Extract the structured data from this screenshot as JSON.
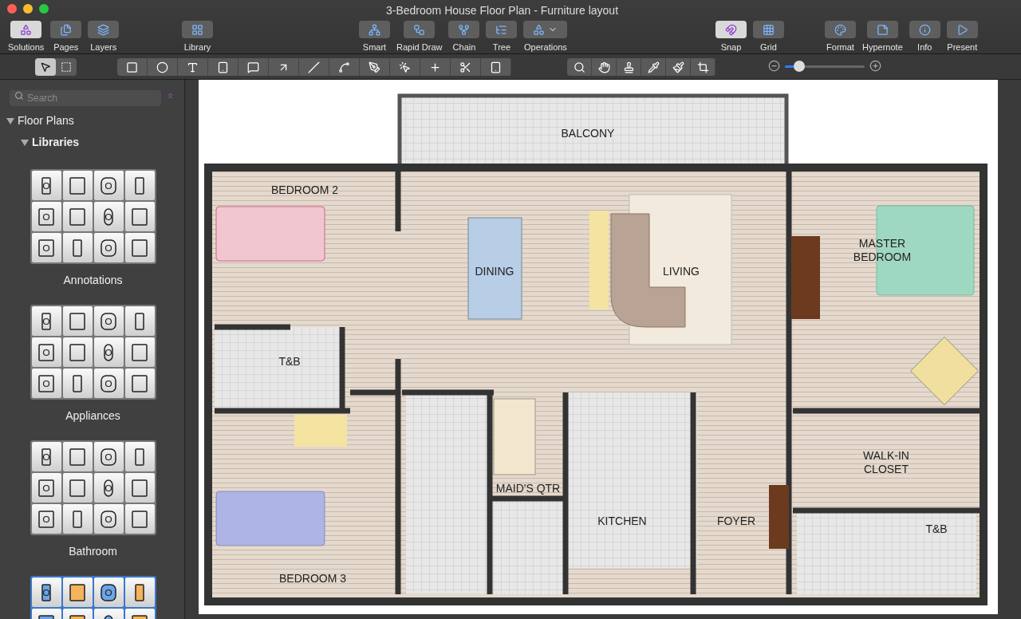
{
  "window": {
    "title": "3-Bedroom House Floor Plan - Furniture layout"
  },
  "toolbar": {
    "view_segments": [
      {
        "label": "Solutions",
        "selected": true
      },
      {
        "label": "Pages",
        "selected": false
      },
      {
        "label": "Layers",
        "selected": false
      }
    ],
    "library": "Library",
    "layout_tools": [
      "Smart",
      "Rapid Draw",
      "Chain",
      "Tree",
      "Operations"
    ],
    "snap": {
      "label": "Snap",
      "on": true
    },
    "grid": {
      "label": "Grid",
      "on": false
    },
    "panel_segments": [
      "Format",
      "Hypernote",
      "Info",
      "Present"
    ]
  },
  "draw_toolbar": {
    "select_tools": [
      {
        "selected": true
      },
      {
        "selected": false
      }
    ],
    "zoom": {
      "level": 0.18
    }
  },
  "sidebar": {
    "search": {
      "placeholder": "Search"
    },
    "tree": [
      {
        "label": "Floor Plans",
        "expanded": true,
        "children": [
          {
            "label": "Libraries",
            "expanded": true
          }
        ]
      }
    ],
    "libraries": [
      {
        "label": "Annotations",
        "selected": false
      },
      {
        "label": "Appliances",
        "selected": false
      },
      {
        "label": "Bathroom",
        "selected": false
      },
      {
        "selected": true
      }
    ]
  },
  "canvas": {
    "rooms": [
      {
        "lines": [
          "BALCONY"
        ]
      },
      {
        "lines": [
          "BEDROOM 2"
        ]
      },
      {
        "lines": [
          "DINING"
        ]
      },
      {
        "lines": [
          "LIVING"
        ]
      },
      {
        "lines": [
          "MASTER",
          "BEDROOM"
        ]
      },
      {
        "lines": [
          "T&B"
        ]
      },
      {
        "lines": [
          "MAID'S QTR"
        ]
      },
      {
        "lines": [
          "KITCHEN"
        ]
      },
      {
        "lines": [
          "FOYER"
        ]
      },
      {
        "lines": [
          "WALK-IN",
          "CLOSET"
        ]
      },
      {
        "lines": [
          "T&B"
        ]
      },
      {
        "lines": [
          "BEDROOM 3"
        ]
      }
    ]
  }
}
